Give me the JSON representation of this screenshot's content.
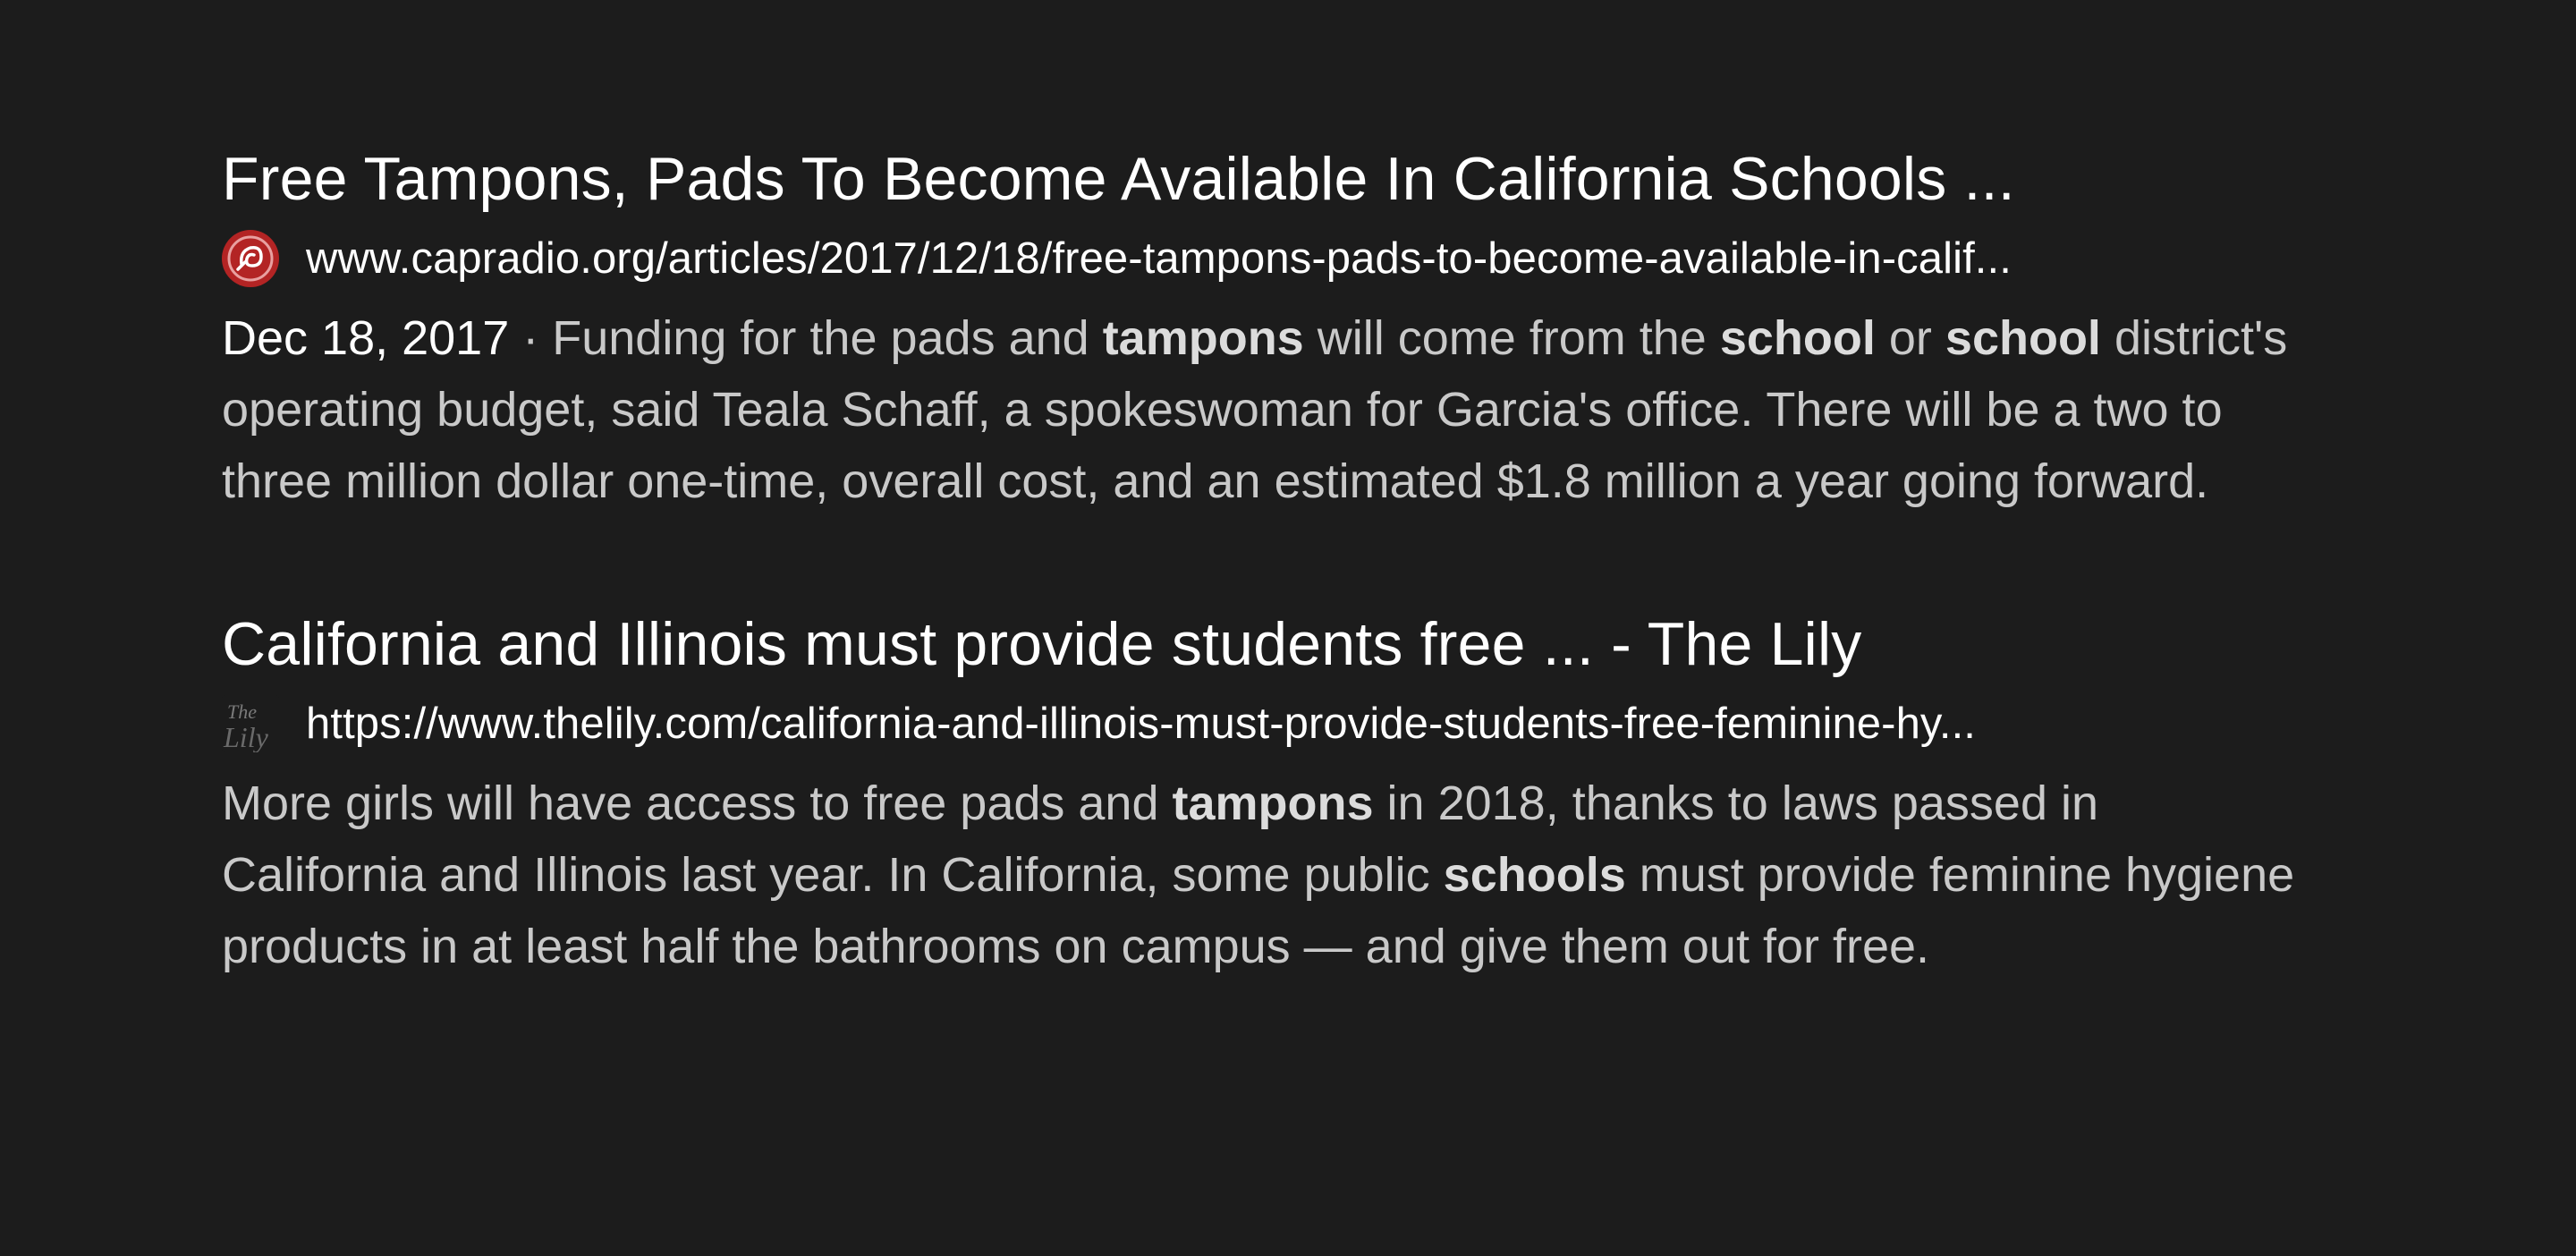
{
  "results": [
    {
      "title": "Free Tampons, Pads To Become Available In California Schools ...",
      "favicon_icon": "capradio-logo-icon",
      "favicon_color": "#b32424",
      "url": "www.capradio.org/articles/2017/12/18/free-tampons-pads-to-become-available-in-calif...",
      "date": "Dec 18, 2017",
      "separator": "·",
      "snippet_parts": [
        " Funding for the pads and ",
        "tampons",
        " will come from the ",
        "school",
        " or ",
        "school",
        " district's operating budget, said Teala Schaff, a spokeswoman for Garcia's office. There will be a two to three million dollar one-time, overall cost, and an estimated $1.8 million a year going forward."
      ]
    },
    {
      "title": "California and Illinois must provide students free ... - The Lily",
      "favicon_icon": "the-lily-logo-icon",
      "favicon_text": "The Lily",
      "url": "https://www.thelily.com/california-and-illinois-must-provide-students-free-feminine-hy...",
      "snippet_parts": [
        "More girls will have access to free pads and ",
        "tampons",
        " in 2018, thanks to laws passed in California and Illinois last year. In California, some public ",
        "schools",
        " must provide feminine hygiene products in at least half the bathrooms on campus — and give them out for free."
      ]
    }
  ]
}
